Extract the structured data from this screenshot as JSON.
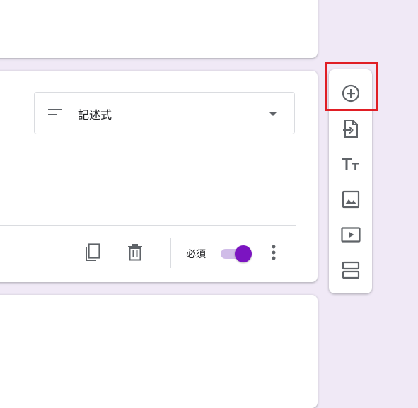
{
  "question": {
    "type_select": {
      "label": "記述式",
      "icon": "short-answer-icon"
    },
    "footer": {
      "copy_icon": "content-copy-icon",
      "delete_icon": "trash-icon",
      "required_label": "必須",
      "required_on": true,
      "more_icon": "more-vert-icon"
    }
  },
  "toolbar": {
    "items": [
      {
        "icon": "add-circle-icon"
      },
      {
        "icon": "import-questions-icon"
      },
      {
        "icon": "title-text-icon"
      },
      {
        "icon": "image-icon"
      },
      {
        "icon": "video-icon"
      },
      {
        "icon": "section-icon"
      }
    ]
  },
  "colors": {
    "background": "#f0e9f6",
    "accent": "#7b14c1",
    "toggle_track": "#d0bce8",
    "highlight": "#e01e25",
    "icon": "#5f6368"
  }
}
